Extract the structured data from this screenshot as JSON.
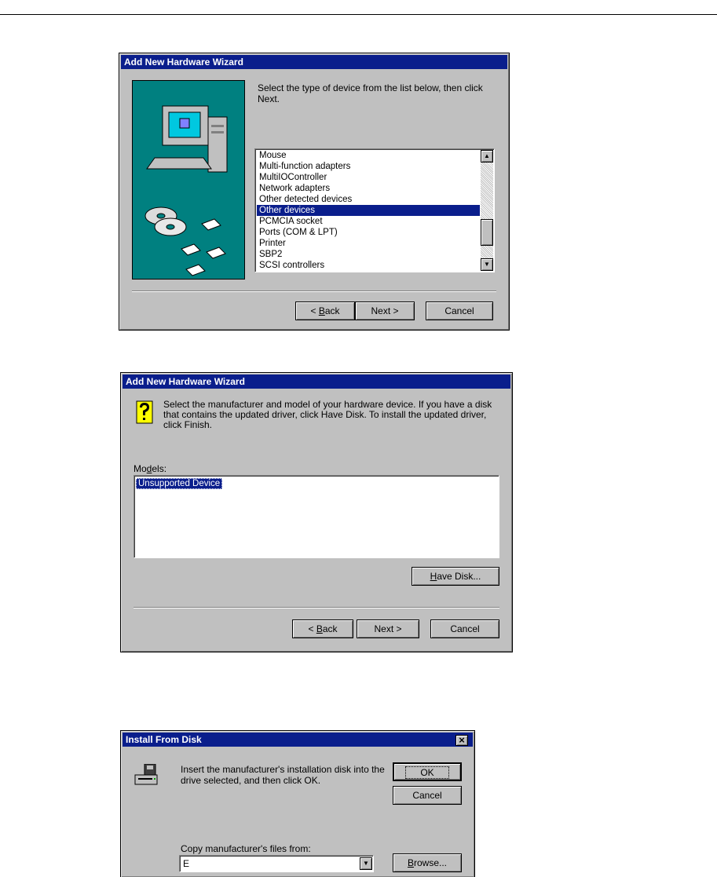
{
  "wizard1": {
    "title": "Add New Hardware Wizard",
    "instructions": "Select the type of device from the list below, then click Next.",
    "device_types": [
      "Mouse",
      "Multi-function adapters",
      "MultiIOController",
      "Network adapters",
      "Other detected devices",
      "Other devices",
      "PCMCIA socket",
      "Ports (COM & LPT)",
      "Printer",
      "SBP2",
      "SCSI controllers"
    ],
    "selected": "Other devices",
    "back_pre": "< ",
    "back_key": "B",
    "back_post": "ack",
    "next_label": "Next >",
    "cancel_label": "Cancel"
  },
  "wizard2": {
    "title": "Add New Hardware Wizard",
    "instructions": "Select the manufacturer and model of your hardware device. If you have a disk that contains the updated driver, click Have Disk. To install the updated driver, click Finish.",
    "models_pre": "Mo",
    "models_key": "d",
    "models_post": "els:",
    "models": [
      "Unsupported Device"
    ],
    "have_disk_key": "H",
    "have_disk_post": "ave Disk...",
    "back_pre": "< ",
    "back_key": "B",
    "back_post": "ack",
    "next_label": "Next >",
    "cancel_label": "Cancel"
  },
  "install_disk": {
    "title": "Install From Disk",
    "close_glyph": "×",
    "message": "Insert the manufacturer's installation disk into the drive selected, and then click OK.",
    "ok_label": "OK",
    "cancel_label": "Cancel",
    "copy_label": "Copy manufacturer's files from:",
    "path_value": "E",
    "browse_key": "B",
    "browse_post": "rowse..."
  }
}
